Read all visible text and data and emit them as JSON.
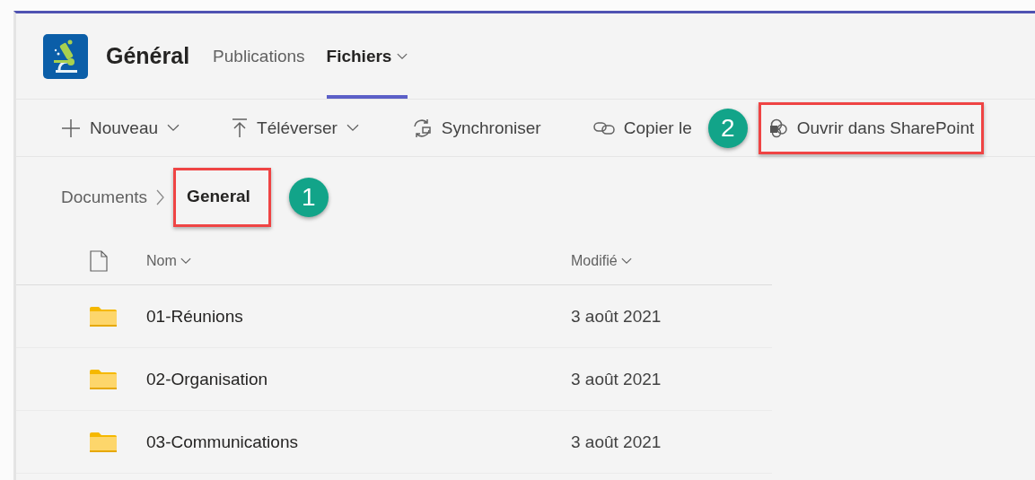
{
  "header": {
    "title": "Général",
    "tabs": [
      {
        "label": "Publications",
        "selected": false,
        "dropdown": false
      },
      {
        "label": "Fichiers",
        "selected": true,
        "dropdown": true
      }
    ]
  },
  "toolbar": [
    {
      "kind": "new",
      "label": "Nouveau",
      "dropdown": true,
      "highlighted": false
    },
    {
      "kind": "upload",
      "label": "Téléverser",
      "dropdown": true,
      "highlighted": false
    },
    {
      "kind": "sync",
      "label": "Synchroniser",
      "dropdown": false,
      "highlighted": false
    },
    {
      "kind": "link",
      "label": "Copier le",
      "dropdown": false,
      "highlighted": false
    },
    {
      "kind": "sharepoint",
      "label": "Ouvrir dans SharePoint",
      "dropdown": false,
      "highlighted": true,
      "callout": "2"
    }
  ],
  "breadcrumb": [
    {
      "label": "Documents",
      "current": false,
      "highlighted": false
    },
    {
      "label": "General",
      "current": true,
      "highlighted": true,
      "callout": "1"
    }
  ],
  "table": {
    "columns": [
      {
        "label": "Nom"
      },
      {
        "label": "Modifié"
      }
    ],
    "rows": [
      {
        "name": "01-Réunions",
        "modified": "3 août 2021"
      },
      {
        "name": "02-Organisation",
        "modified": "3 août 2021"
      },
      {
        "name": "03-Communications",
        "modified": "3 août 2021"
      }
    ]
  }
}
